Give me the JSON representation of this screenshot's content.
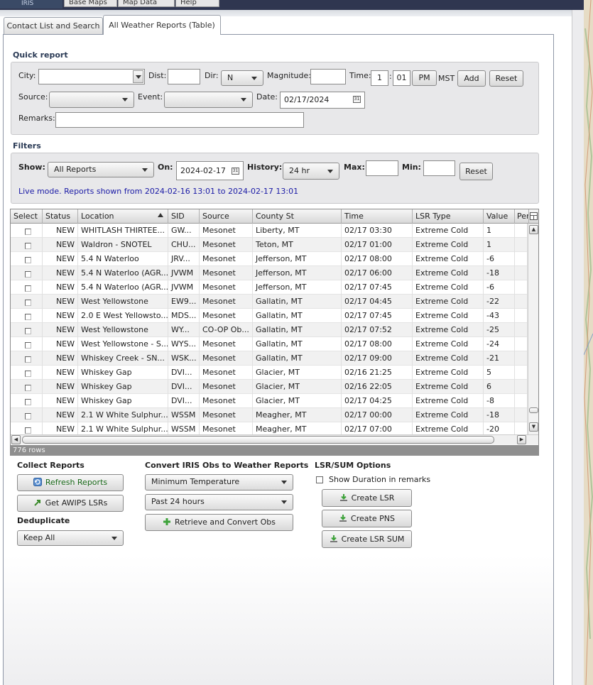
{
  "app": {
    "logo_text": "IRIS",
    "top_menu": [
      "Base Maps",
      "Map Data",
      "Help"
    ]
  },
  "tabs": [
    {
      "label": "Contact List and Search",
      "active": false
    },
    {
      "label": "All Weather Reports (Table)",
      "active": true
    }
  ],
  "quick_report": {
    "title": "Quick report",
    "city_label": "City:",
    "city_value": "",
    "dist_label": "Dist:",
    "dist_value": "",
    "dir_label": "Dir:",
    "dir_value": "N",
    "magnitude_label": "Magnitude:",
    "magnitude_value": "",
    "time_label": "Time:",
    "time_hour": "1",
    "time_sep": ":",
    "time_min": "01",
    "ampm": "PM",
    "tz": "MST",
    "add_label": "Add",
    "reset_label": "Reset",
    "source_label": "Source:",
    "source_value": "",
    "event_label": "Event:",
    "event_value": "",
    "date_label": "Date:",
    "date_value": "02/17/2024",
    "remarks_label": "Remarks:",
    "remarks_value": "",
    "calendar_glyph": "31"
  },
  "filters": {
    "title": "Filters",
    "show_label": "Show:",
    "show_value": "All Reports",
    "on_label": "On:",
    "on_value": "2024-02-17",
    "history_label": "History:",
    "history_value": "24 hr",
    "max_label": "Max:",
    "max_value": "",
    "min_label": "Min:",
    "min_value": "",
    "reset_label": "Reset",
    "live_text": "Live mode. Reports shown from 2024-02-16 13:01 to 2024-02-17 13:01"
  },
  "table": {
    "columns": [
      "Select",
      "Status",
      "Location",
      "SID",
      "Source",
      "County St",
      "Time",
      "LSR Type",
      "Value",
      "Per"
    ],
    "rows": [
      {
        "status": "NEW",
        "location": "WHITLASH THIRTEE...",
        "sid": "GW...",
        "source": "Mesonet",
        "county": "Liberty, MT",
        "time": "02/17 03:30",
        "lsr": "Extreme Cold",
        "value": "1"
      },
      {
        "status": "NEW",
        "location": "Waldron - SNOTEL",
        "sid": "CHU...",
        "source": "Mesonet",
        "county": "Teton, MT",
        "time": "02/17 01:00",
        "lsr": "Extreme Cold",
        "value": "1"
      },
      {
        "status": "NEW",
        "location": "5.4 N Waterloo",
        "sid": "JRV...",
        "source": "Mesonet",
        "county": "Jefferson, MT",
        "time": "02/17 08:00",
        "lsr": "Extreme Cold",
        "value": "-6"
      },
      {
        "status": "NEW",
        "location": "5.4 N Waterloo (AGR...",
        "sid": "JVWM",
        "source": "Mesonet",
        "county": "Jefferson, MT",
        "time": "02/17 06:00",
        "lsr": "Extreme Cold",
        "value": "-18"
      },
      {
        "status": "NEW",
        "location": "5.4 N Waterloo (AGR...",
        "sid": "JVWM",
        "source": "Mesonet",
        "county": "Jefferson, MT",
        "time": "02/17 07:45",
        "lsr": "Extreme Cold",
        "value": "-6"
      },
      {
        "status": "NEW",
        "location": "West Yellowstone",
        "sid": "EW9...",
        "source": "Mesonet",
        "county": "Gallatin, MT",
        "time": "02/17 04:45",
        "lsr": "Extreme Cold",
        "value": "-22"
      },
      {
        "status": "NEW",
        "location": "2.0 E West Yellowsto...",
        "sid": "MDS...",
        "source": "Mesonet",
        "county": "Gallatin, MT",
        "time": "02/17 07:45",
        "lsr": "Extreme Cold",
        "value": "-43"
      },
      {
        "status": "NEW",
        "location": "West Yellowstone",
        "sid": "WY...",
        "source": "CO-OP Ob...",
        "county": "Gallatin, MT",
        "time": "02/17 07:52",
        "lsr": "Extreme Cold",
        "value": "-25"
      },
      {
        "status": "NEW",
        "location": "West Yellowstone - S...",
        "sid": "WYS...",
        "source": "Mesonet",
        "county": "Gallatin, MT",
        "time": "02/17 08:00",
        "lsr": "Extreme Cold",
        "value": "-24"
      },
      {
        "status": "NEW",
        "location": "Whiskey Creek - SN...",
        "sid": "WSK...",
        "source": "Mesonet",
        "county": "Gallatin, MT",
        "time": "02/17 09:00",
        "lsr": "Extreme Cold",
        "value": "-21"
      },
      {
        "status": "NEW",
        "location": "Whiskey Gap",
        "sid": "DVI...",
        "source": "Mesonet",
        "county": "Glacier, MT",
        "time": "02/16 21:25",
        "lsr": "Extreme Cold",
        "value": "5"
      },
      {
        "status": "NEW",
        "location": "Whiskey Gap",
        "sid": "DVI...",
        "source": "Mesonet",
        "county": "Glacier, MT",
        "time": "02/16 22:05",
        "lsr": "Extreme Cold",
        "value": "6"
      },
      {
        "status": "NEW",
        "location": "Whiskey Gap",
        "sid": "DVI...",
        "source": "Mesonet",
        "county": "Glacier, MT",
        "time": "02/17 04:25",
        "lsr": "Extreme Cold",
        "value": "-8"
      },
      {
        "status": "NEW",
        "location": "2.1 W White Sulphur...",
        "sid": "WSSM",
        "source": "Mesonet",
        "county": "Meagher, MT",
        "time": "02/17 00:00",
        "lsr": "Extreme Cold",
        "value": "-18"
      },
      {
        "status": "NEW",
        "location": "2.1 W White Sulphur...",
        "sid": "WSSM",
        "source": "Mesonet",
        "county": "Meagher, MT",
        "time": "02/17 07:00",
        "lsr": "Extreme Cold",
        "value": "-20"
      }
    ],
    "row_count": "776 rows"
  },
  "collect": {
    "title": "Collect Reports",
    "refresh_label": "Refresh Reports",
    "awips_label": "Get AWIPS LSRs",
    "dedupe_title": "Deduplicate",
    "dedupe_value": "Keep All"
  },
  "convert": {
    "title": "Convert IRIS Obs to Weather Reports",
    "type_value": "Minimum Temperature",
    "period_value": "Past 24 hours",
    "retrieve_label": "Retrieve and Convert Obs"
  },
  "lsr": {
    "title": "LSR/SUM Options",
    "show_duration_label": "Show Duration in remarks",
    "show_duration_checked": false,
    "create_lsr_label": "Create LSR",
    "create_pns_label": "Create PNS",
    "create_sum_label": "Create LSR SUM"
  },
  "colors": {
    "accent": "#2a3a55",
    "live_text": "#1a1aa6",
    "refresh_text": "#1a6a1a",
    "topbar": "#2f3650"
  }
}
